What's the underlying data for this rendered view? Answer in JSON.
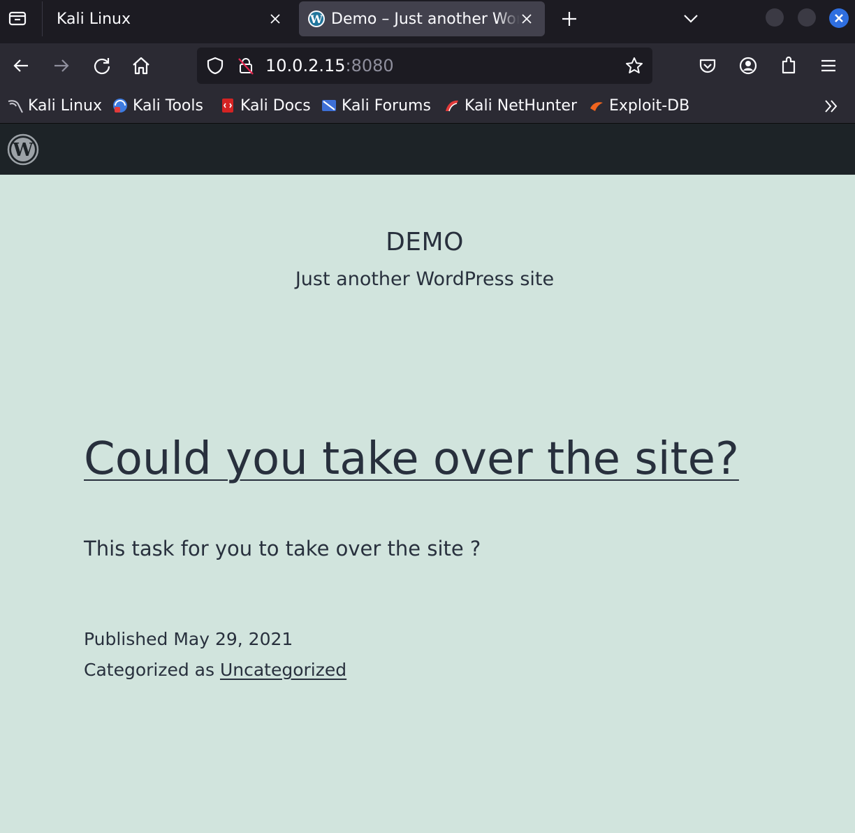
{
  "browser": {
    "tabs": [
      {
        "label": "Kali Linux",
        "active": false
      },
      {
        "label": "Demo – Just another WordPress site",
        "active": true
      }
    ],
    "url": {
      "host": "10.0.2.15",
      "port": ":8080"
    },
    "bookmarks": [
      {
        "label": "Kali Linux",
        "icon": "kali-dragon-icon"
      },
      {
        "label": "Kali Tools",
        "icon": "kali-tools-icon"
      },
      {
        "label": "Kali Docs",
        "icon": "kali-docs-icon"
      },
      {
        "label": "Kali Forums",
        "icon": "kali-forums-icon"
      },
      {
        "label": "Kali NetHunter",
        "icon": "kali-nethunter-icon"
      },
      {
        "label": "Exploit-DB",
        "icon": "exploit-db-icon"
      }
    ],
    "colors": {
      "accent": "#2f6fe0",
      "toolbar": "#2b2a33",
      "tabstrip": "#1c1b22"
    }
  },
  "wp_admin_bar": {
    "logo": "wordpress-logo-icon",
    "background": "#1d2327"
  },
  "site": {
    "title": "DEMO",
    "description": "Just another WordPress site",
    "background": "#d1e4dd"
  },
  "post": {
    "title": "Could you take over the site?",
    "body": "This task for you to take over the site ?",
    "published_prefix": "Published",
    "published_date": "May 29, 2021",
    "category_prefix": "Categorized as",
    "category": "Uncategorized"
  }
}
